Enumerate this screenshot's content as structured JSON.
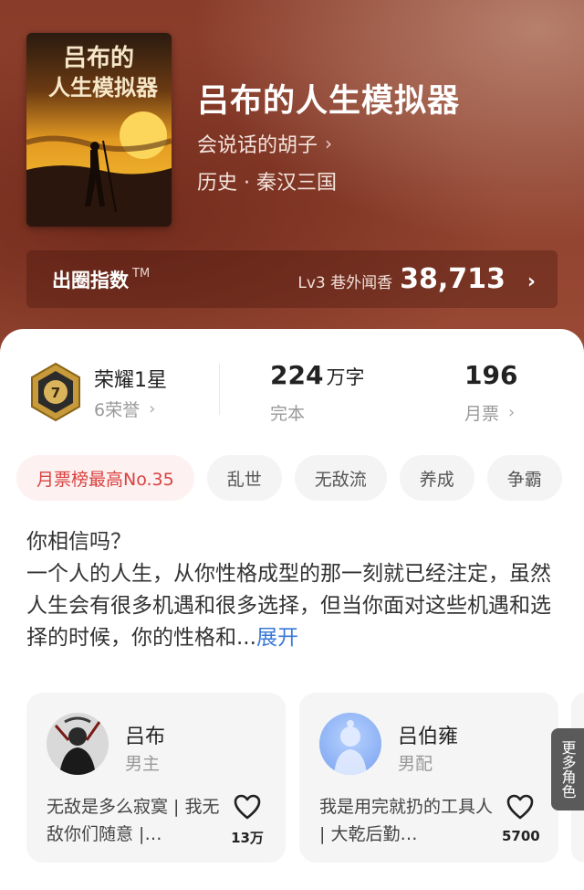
{
  "book": {
    "cover_text": "吕布的人生模拟器",
    "title": "吕布的人生模拟器",
    "author": "会说话的胡子",
    "category": "历史 · 秦汉三国"
  },
  "circle_index": {
    "label": "出圈指数",
    "tm": "TM",
    "level_text": "Lv3 巷外闻香",
    "value": "38,713"
  },
  "stats": {
    "honor_title": "荣耀1星",
    "honor_count": "6荣誉",
    "badge_level": "7",
    "words_number": "224",
    "words_unit": "万字",
    "status": "完本",
    "monthly_tickets": "196",
    "tickets_label": "月票"
  },
  "tags": [
    "月票榜最高No.35",
    "乱世",
    "无敌流",
    "养成",
    "争霸"
  ],
  "synopsis": {
    "text": "你相信吗？\n一个人的人生，从你性格成型的那一刻就已经注定，虽然人生会有很多机遇和很多选择，但当你面对这些机遇和选择的时候，你的性格和...",
    "expand": "展开"
  },
  "characters": [
    {
      "name": "吕布",
      "role": "男主",
      "desc": "无敌是多么寂寞 | 我无敌你们随意 |…",
      "likes": "13万"
    },
    {
      "name": "吕伯雍",
      "role": "男配",
      "desc": "我是用完就扔的工具人 | 大乾后勤…",
      "likes": "5700"
    }
  ],
  "more_characters": "更多角色",
  "colors": {
    "hero_bg": "#8f412e",
    "tag_rank_text": "#d9413f",
    "link_blue": "#3b79d8"
  }
}
